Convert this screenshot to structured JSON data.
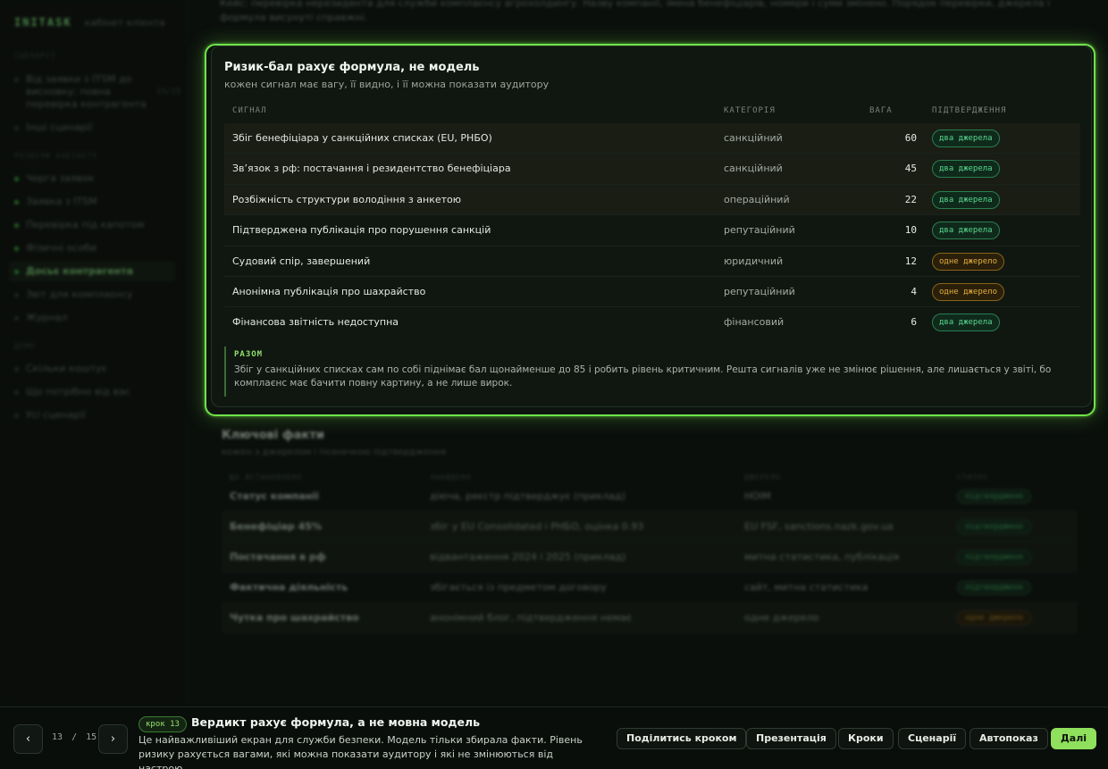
{
  "app": {
    "logo": "INITASK",
    "subtitle": "кабінет клієнта"
  },
  "sidebar": {
    "sections": [
      {
        "label": "СЦЕНАРІЇ"
      },
      {
        "label": "РОЗДІЛИ КАБІНЕТУ"
      },
      {
        "label": "ДЕМО"
      }
    ],
    "scenarios": [
      {
        "label": "Від заявки з ITSM до висновку: повна перевірка контрагента",
        "count": "15/15"
      },
      {
        "label": "Інші сценарії"
      }
    ],
    "sections_items": [
      {
        "label": "Черга заявок"
      },
      {
        "label": "Заявка з ITSM"
      },
      {
        "label": "Перевірка під капотом"
      },
      {
        "label": "Фізичні особи"
      },
      {
        "label": "Досьє контрагента"
      },
      {
        "label": "Звіт для комплаєнсу"
      },
      {
        "label": "Журнал"
      }
    ],
    "demo_items": [
      {
        "label": "Скільки коштує"
      },
      {
        "label": "Що потрібно від вас"
      },
      {
        "label": "Усі сценарії"
      }
    ]
  },
  "top_note": "Кейс: перевірка нерезидента для служби комплаєнсу агрохолдингу. Назву компанії, імена бенефіціарів, номери і суми змінено. Порядок перевірки, джерела і формула висунуті справжні.",
  "risk_panel": {
    "title": "Ризик-бал рахує формула, не модель",
    "subtitle": "кожен сигнал має вагу, її видно, і її можна показати аудитору",
    "columns": {
      "signal": "СИГНАЛ",
      "category": "КАТЕГОРІЯ",
      "weight": "ВАГА",
      "confirmation": "ПІДТВЕРДЖЕННЯ"
    },
    "rows": [
      {
        "signal": "Збіг бенефіціара у санкційних списках (EU, РНБО)",
        "category": "санкційний",
        "weight": "60",
        "confirmation": "два джерела",
        "confirmation_type": "two"
      },
      {
        "signal": "Зв’язок з рф: постачання і резидентство бенефіціара",
        "category": "санкційний",
        "weight": "45",
        "confirmation": "два джерела",
        "confirmation_type": "two"
      },
      {
        "signal": "Розбіжність структури володіння з анкетою",
        "category": "операційний",
        "weight": "22",
        "confirmation": "два джерела",
        "confirmation_type": "two"
      },
      {
        "signal": "Підтверджена публікація про порушення санкцій",
        "category": "репутаційний",
        "weight": "10",
        "confirmation": "два джерела",
        "confirmation_type": "two"
      },
      {
        "signal": "Судовий спір, завершений",
        "category": "юридичний",
        "weight": "12",
        "confirmation": "одне джерело",
        "confirmation_type": "one"
      },
      {
        "signal": "Анонімна публікація про шахрайство",
        "category": "репутаційний",
        "weight": "4",
        "confirmation": "одне джерело",
        "confirmation_type": "one"
      },
      {
        "signal": "Фінансова звітність недоступна",
        "category": "фінансовий",
        "weight": "6",
        "confirmation": "два джерела",
        "confirmation_type": "two"
      }
    ],
    "summary_label": "РАЗОМ",
    "summary_text": "Збіг у санкційних списках сам по собі піднімає бал щонайменше до 85 і робить рівень критичним. Решта сигналів уже не змінює рішення, але лишається у звіті, бо комплаєнс має бачити повну картину, а не лише вирок."
  },
  "facts": {
    "title": "Ключові факти",
    "subtitle": "кожен з джерелом і позначкою підтвердження",
    "columns": [
      "ЩО ВСТАНОВЛЕНО",
      "ЗНАЙДЕНО",
      "ДЖЕРЕЛО",
      "СТАТУС"
    ],
    "rows": [
      {
        "fact": "Статус компанії",
        "found": "діюча, реєстр підтверджує (приклад)",
        "source": "НОІМ",
        "status": "підтверджено",
        "type": "two"
      },
      {
        "fact": "Бенефіціар 45%",
        "found": "збіг у EU Consolidated і РНБО, оцінка 0.93",
        "source": "EU FSF, sanctions.nazk.gov.ua",
        "status": "підтверджено",
        "type": "two"
      },
      {
        "fact": "Постачання в рф",
        "found": "відвантаження 2024 і 2025 (приклад)",
        "source": "митна статистика, публікація",
        "status": "підтверджено",
        "type": "two"
      },
      {
        "fact": "Фактична діяльність",
        "found": "збігається із предметом договору",
        "source": "сайт, митна статистика",
        "status": "підтверджено",
        "type": "two"
      },
      {
        "fact": "Чутка про шахрайство",
        "found": "анонімний блог, підтвердження немає",
        "source": "одне джерело",
        "status": "одне джерело",
        "type": "one"
      }
    ]
  },
  "bottom_bar": {
    "prev_icon": "‹",
    "next_icon": "›",
    "page_current": "13",
    "page_sep": "/",
    "page_total": "15",
    "step_label": "крок 13",
    "step_title": "Вердикт рахує формула, а не мовна модель",
    "step_description": "Це найважливіший екран для служби безпеки. Модель тільки збирала факти. Рівень ризику рахується вагами, які можна показати аудитору і які не змінюються від настрою…",
    "buttons": {
      "share": "Поділитись кроком",
      "presentation": "Презентація",
      "steps": "Кроки",
      "scenarios": "Сценарії",
      "autoplay": "Автопоказ",
      "next": "Далі"
    }
  },
  "colors": {
    "accent": "#8fe05c",
    "panel_border": "#6fe349",
    "badge_two": "#59d68e",
    "badge_one": "#e3ad3c"
  }
}
